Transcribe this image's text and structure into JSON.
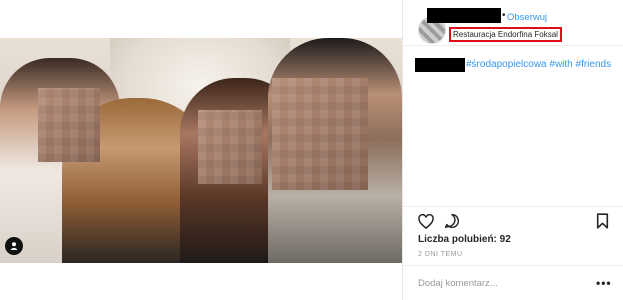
{
  "post": {
    "follow_label": "Obserwuj",
    "dot": "•",
    "location": "Restauracja Endorfina Foksal",
    "caption_tags": "#środapopielcowa #with #friends",
    "likes_text": "Liczba polubień: 92",
    "time_text": "2 DNI TEMU",
    "comment_placeholder": "Dodaj komentarz...",
    "more_label": "•••"
  },
  "icons": {
    "tag": "person-tag-icon",
    "heart": "heart-icon",
    "comment": "comment-icon",
    "save": "bookmark-icon"
  },
  "colors": {
    "link": "#3897f0",
    "location_highlight": "#e0101a",
    "redaction": "#000000"
  }
}
